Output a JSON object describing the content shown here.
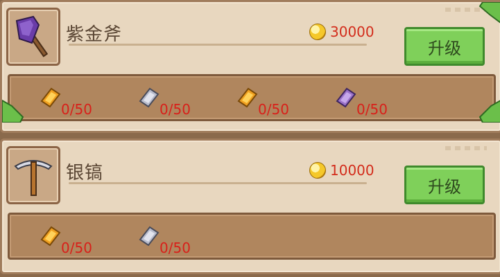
{
  "items": [
    {
      "title": "紫金斧",
      "icon": "purple-axe-icon",
      "price": "30000",
      "upgrade_label": "升级",
      "materials": [
        {
          "icon": "gold-ingot-icon",
          "count": "0/50",
          "color": "#f0a020"
        },
        {
          "icon": "silver-ingot-icon",
          "count": "0/50",
          "color": "#b8bccc"
        },
        {
          "icon": "gold-ingot-icon",
          "count": "0/50",
          "color": "#f0a020"
        },
        {
          "icon": "purple-ingot-icon",
          "count": "0/50",
          "color": "#9a72c8"
        }
      ]
    },
    {
      "title": "银镐",
      "icon": "silver-pickaxe-icon",
      "price": "10000",
      "upgrade_label": "升级",
      "materials": [
        {
          "icon": "gold-ingot-icon",
          "count": "0/50",
          "color": "#f0a020"
        },
        {
          "icon": "silver-ingot-icon",
          "count": "0/50",
          "color": "#b8bccc"
        }
      ]
    }
  ],
  "colors": {
    "price_text": "#d32d1c",
    "count_text": "#d8201a",
    "button_green": "#7fd05a",
    "panel_bg": "#e8d7bf"
  }
}
